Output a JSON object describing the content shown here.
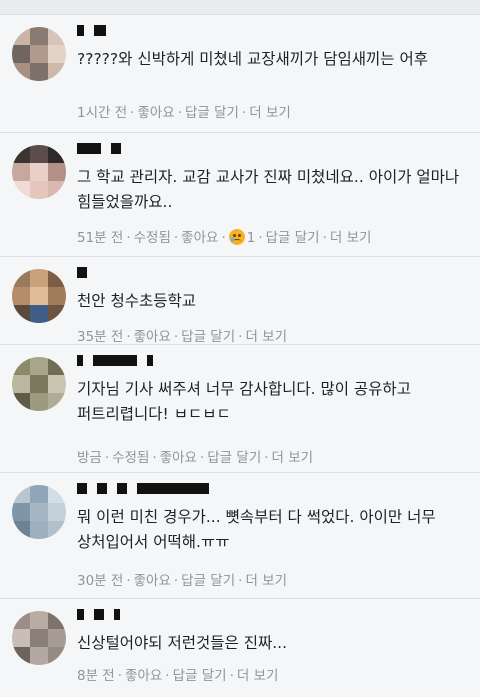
{
  "comments": [
    {
      "text": "?????와 신박하게 미쳤네 교장새끼가 담임새끼는 어후",
      "time": "1시간 전",
      "edited": "",
      "like": "좋아요",
      "reaction_count": "",
      "reply": "답글 달기",
      "more": "더 보기",
      "avatar_colors": [
        "#c9b4a6",
        "#8a7b72",
        "#d8c4b6",
        "#6f665f",
        "#b09a8c",
        "#e2d2c7",
        "#a89080",
        "#7d7068",
        "#cdb8aa"
      ]
    },
    {
      "text": "그 학교 관리자. 교감 교사가 진짜 미쳤네요.. 아이가 얼마나 힘들었을까요..",
      "time": "51분 전",
      "edited": "수정됨",
      "like": "좋아요",
      "reaction_count": "1",
      "reply": "답글 달기",
      "more": "더 보기",
      "avatar_colors": [
        "#3a3433",
        "#5a4d4a",
        "#2e2a2a",
        "#c7a89e",
        "#e8cfc7",
        "#b39088",
        "#f0dcd5",
        "#e4c6bd",
        "#d9b8ae"
      ]
    },
    {
      "text": "천안 청수초등학교",
      "time": "35분 전",
      "edited": "",
      "like": "좋아요",
      "reaction_count": "",
      "reply": "답글 달기",
      "more": "더 보기",
      "avatar_colors": [
        "#9a7a5c",
        "#c9a27c",
        "#7d5e44",
        "#b58d6b",
        "#e0bd98",
        "#a27d5d",
        "#5b4a3c",
        "#3e5d87",
        "#6e5441"
      ]
    },
    {
      "text": "기자님 기사 써주셔 너무 감사합니다. 많이 공유하고 퍼트리렵니다! ㅂㄷㅂㄷ",
      "time": "방금",
      "edited": "수정됨",
      "like": "좋아요",
      "reaction_count": "",
      "reply": "답글 달기",
      "more": "더 보기",
      "avatar_colors": [
        "#8c8a6a",
        "#a7a58a",
        "#6f6d52",
        "#b9b79e",
        "#7a785e",
        "#c8c6b0",
        "#5e5c45",
        "#9b997e",
        "#aeac95"
      ]
    },
    {
      "text": "뭐 이런 미친 경우가... 뼛속부터 다 썩었다. 아이만 너무 상처입어서 어떡해.ㅠㅠ",
      "time": "30분 전",
      "edited": "",
      "like": "좋아요",
      "reaction_count": "",
      "reply": "답글 달기",
      "more": "더 보기",
      "avatar_colors": [
        "#b9c6d2",
        "#8fa6b8",
        "#d3dde6",
        "#7f95a8",
        "#a5b6c4",
        "#c4d0da",
        "#6d8296",
        "#9db0bf",
        "#b0c0cd"
      ]
    },
    {
      "text": "신상털어야되 저런것들은 진짜...",
      "time": "8분 전",
      "edited": "",
      "like": "좋아요",
      "reaction_count": "",
      "reply": "답글 달기",
      "more": "더 보기",
      "avatar_colors": [
        "#9b8e86",
        "#b8aca4",
        "#7e726b",
        "#c9beb7",
        "#8a7f78",
        "#a79c95",
        "#6d635d",
        "#b4a9a2",
        "#968b84"
      ]
    }
  ]
}
